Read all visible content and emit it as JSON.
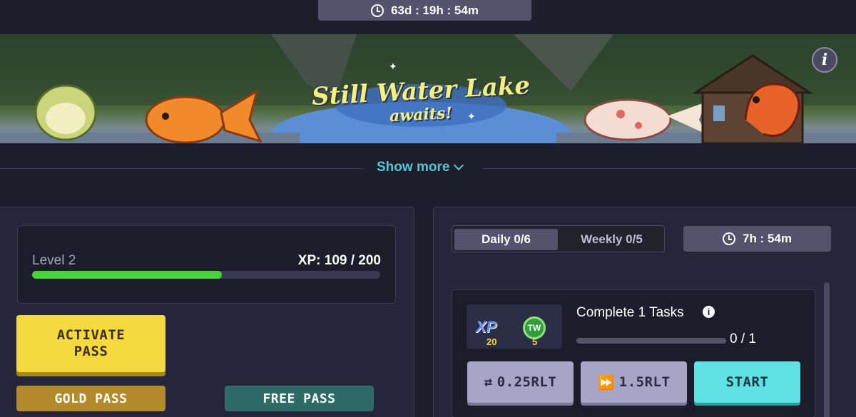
{
  "season_timer": {
    "value": "63d : 19h : 54m",
    "icon": "clock-icon"
  },
  "banner": {
    "title": "Still Water Lake",
    "subtitle": "awaits!",
    "info_icon_text": "i"
  },
  "show_more": {
    "label": "Show more",
    "icon": "chevron-down-icon"
  },
  "pass_panel": {
    "level_label": "Level 2",
    "xp_label": "XP: 109 / 200",
    "xp_current": 109,
    "xp_max": 200,
    "activate_label_line1": "ACTIVATE",
    "activate_label_line2": "PASS",
    "gold_pass_label": "GOLD PASS",
    "free_pass_label": "FREE PASS"
  },
  "tasks_panel": {
    "tabs": [
      {
        "label": "Daily 0/6",
        "active": true
      },
      {
        "label": "Weekly 0/5",
        "active": false
      }
    ],
    "timer": "7h : 54m",
    "task": {
      "reward_xp_label": "XP",
      "reward_xp_amount": "20",
      "reward_token_label": "TW",
      "reward_token_amount": "5",
      "title": "Complete 1 Tasks",
      "info_icon_text": "i",
      "progress_label": "0 / 1",
      "progress_fraction": 0,
      "buttons": {
        "skip_price": "0.25RLT",
        "skip_icon": "swap-arrows-icon",
        "fast_price": "1.5RLT",
        "fast_icon": "fast-forward-icon",
        "start": "START"
      }
    }
  },
  "colors": {
    "background": "#1d1d2b",
    "accent_cyan": "#52c7d6",
    "xp_green": "#4bd23a",
    "activate_yellow": "#f6d93f",
    "gold": "#b28a2a",
    "free_teal": "#2e6b66",
    "start_cyan": "#5fe0e2"
  }
}
